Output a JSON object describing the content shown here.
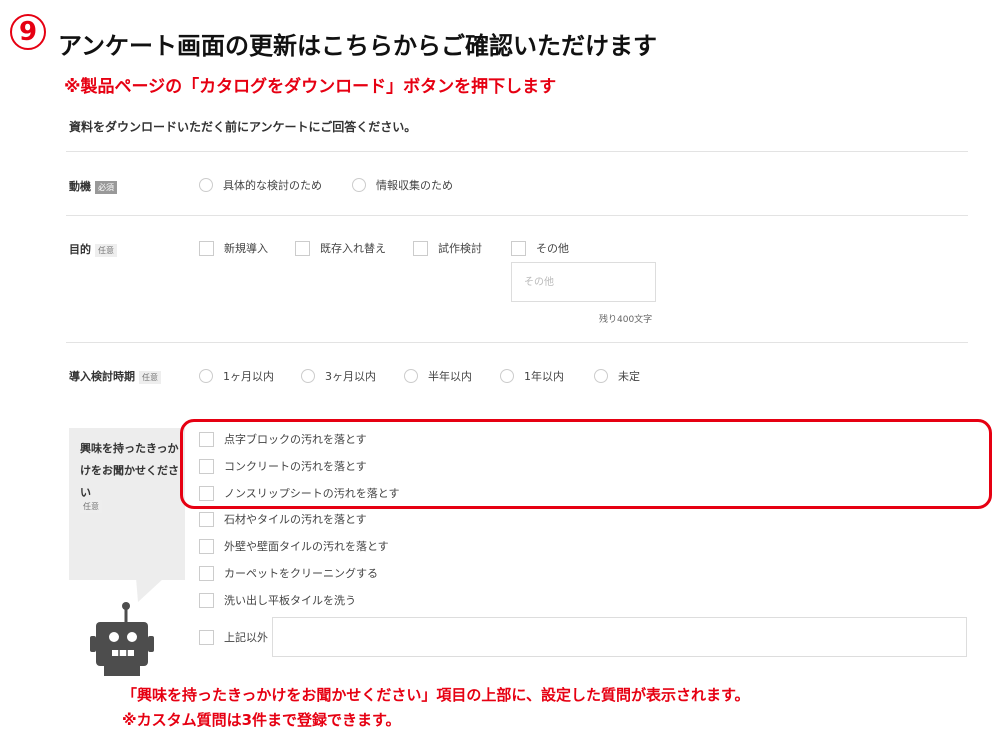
{
  "header": {
    "step_number": "9",
    "title": "アンケート画面の更新はこちらからご確認いただけます",
    "instruction": "※製品ページの「カタログをダウンロード」ボタンを押下します"
  },
  "form": {
    "intro": "資料をダウンロードいただく前にアンケートにご回答ください。",
    "motivation": {
      "label": "動機",
      "tag": "必須",
      "options": [
        "具体的な検討のため",
        "情報収集のため"
      ]
    },
    "purpose": {
      "label": "目的",
      "tag": "任意",
      "options": [
        "新規導入",
        "既存入れ替え",
        "試作検討",
        "その他"
      ],
      "other_placeholder": "その他",
      "counter": "残り400文字"
    },
    "timing": {
      "label": "導入検討時期",
      "tag": "任意",
      "options": [
        "1ヶ月以内",
        "3ヶ月以内",
        "半年以内",
        "1年以内",
        "未定"
      ]
    },
    "interest": {
      "label": "興味を持ったきっかけをお聞かせください",
      "tag": "任意",
      "custom_options": [
        "点字ブロックの汚れを落とす",
        "コンクリートの汚れを落とす",
        "ノンスリップシートの汚れを落とす"
      ],
      "options": [
        "石材やタイルの汚れを落とす",
        "外壁や壁面タイルの汚れを落とす",
        "カーペットをクリーニングする",
        "洗い出し平板タイルを洗う"
      ],
      "other_label": "上記以外"
    }
  },
  "footer_notes": {
    "line1": "「興味を持ったきっかけをお聞かせください」項目の上部に、設定した質問が表示されます。",
    "line2": "※カスタム質問は3件まで登録できます。"
  },
  "colors": {
    "accent": "#e60012",
    "robot": "#4d4d4d"
  }
}
